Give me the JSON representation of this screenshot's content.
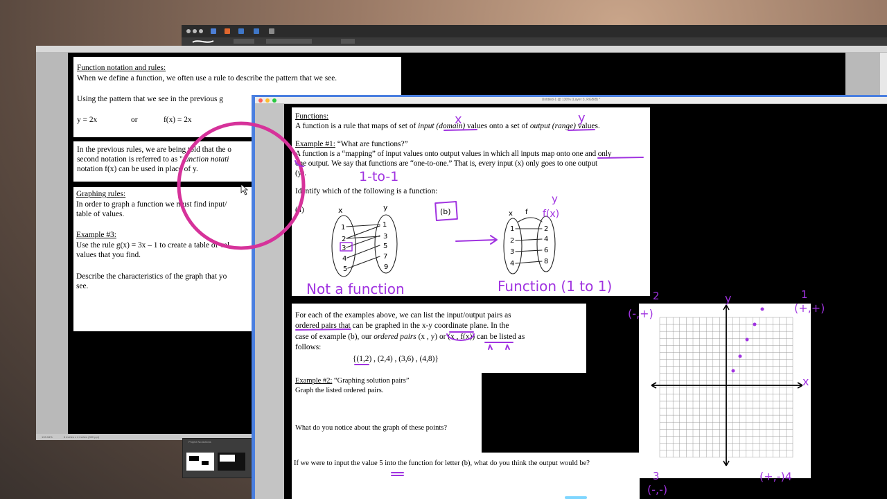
{
  "back_window": {
    "section1": {
      "heading": "Function notation and rules:",
      "line1": "When we define a function, we often use a rule to describe the pattern that we see.",
      "line2": "Using the pattern that we see in the previous g",
      "formula_left": "y = 2x",
      "formula_or": "or",
      "formula_right": "f(x) = 2x"
    },
    "section2": {
      "line1": "In the previous rules, we are being told that the o",
      "line2_a": "second notation is referred to as \"",
      "line2_b": "function notati",
      "line3": "notation f(x) can be used in place of y."
    },
    "section3": {
      "heading": "Graphing rules:",
      "line1": "In order to graph a function we must find input/",
      "line2": "table of values.",
      "example_heading": "Example #3:",
      "example_line1": "Use the rule g(x) = 3x – 1 to create a table of val",
      "example_line2": "values that you find.",
      "describe_line1": "Describe the characteristics of the graph that yo",
      "describe_line2": "see."
    },
    "status": "6 inches x 4 inches (300 ppi)",
    "zoom": "133.34%",
    "panel_title": "Project No Actions"
  },
  "front_window": {
    "title": "Untitled-1 @ 130% (Layer 3, RGB/8) *",
    "functions": {
      "heading": "Functions:",
      "line1_a": "A function is a rule that maps of set of ",
      "line1_b": "input (domain)",
      "line1_c": " values onto a set of ",
      "line1_d": "output (range)",
      "line1_e": " values.",
      "example_heading": "Example #1:",
      "example_title": "  “What are functions?”",
      "def_line1": "A function is a “mapping” of input values onto output values in which all inputs map onto one and only",
      "def_line2": "one output.  We say that functions are “one-to-one.”  That is, every input (x) only goes to one output",
      "def_line3": "(y).",
      "identify": "Identify which of the following is a function:",
      "label_a": "(a)"
    },
    "ordered_pairs": {
      "line1": "For each of the examples above, we can list the input/output pairs as",
      "line2_a": "ordered pairs",
      "line2_b": " that can be graphed in the x-y coordinate plane.  In the",
      "line3_a": "case of example (b), our ",
      "line3_b": "ordered pairs",
      "line3_c": " (x , y) or (x , f(x)) can be listed as",
      "line4": "follows:",
      "set": "{(1,2) , (2,4) , (3,6) , (4,8)}"
    },
    "example2": {
      "heading": "Example #2:",
      "title": "  “Graphing solution pairs”",
      "line1": "Graph the listed ordered pairs.",
      "notice": "What do you notice about the graph of these points?",
      "question": "If we were to input the value 5 into the function for letter (b), what do you think the output would be?"
    },
    "handwriting": {
      "x_mark": "x",
      "y_mark": "y",
      "one_to_one": "1-to-1",
      "b_label": "(b)",
      "y_top": "y",
      "fx": "f(x)",
      "not_function": "Not a function",
      "function_1to1": "Function (1 to 1)",
      "q2": "2",
      "q1": "1",
      "q3": "3",
      "q4": "(+,-)4",
      "sign_q2": "(-,+)",
      "sign_q1": "(+,+)",
      "sign_q3": "(-,-)",
      "axis_x": "x",
      "axis_y": "y"
    },
    "mapping_a": {
      "x_label": "x",
      "y_label": "y",
      "x_values": [
        "1",
        "2",
        "3",
        "4",
        "5"
      ],
      "y_values": [
        "1",
        "3",
        "5",
        "7",
        "9"
      ]
    },
    "mapping_b": {
      "x_label": "x",
      "f_label": "f",
      "x_values": [
        "1",
        "2",
        "3",
        "4"
      ],
      "y_values": [
        "2",
        "4",
        "6",
        "8"
      ]
    }
  },
  "colors": {
    "ink": "#a033e0",
    "circle": "#d6329a",
    "accent": "#4a7fe0"
  }
}
